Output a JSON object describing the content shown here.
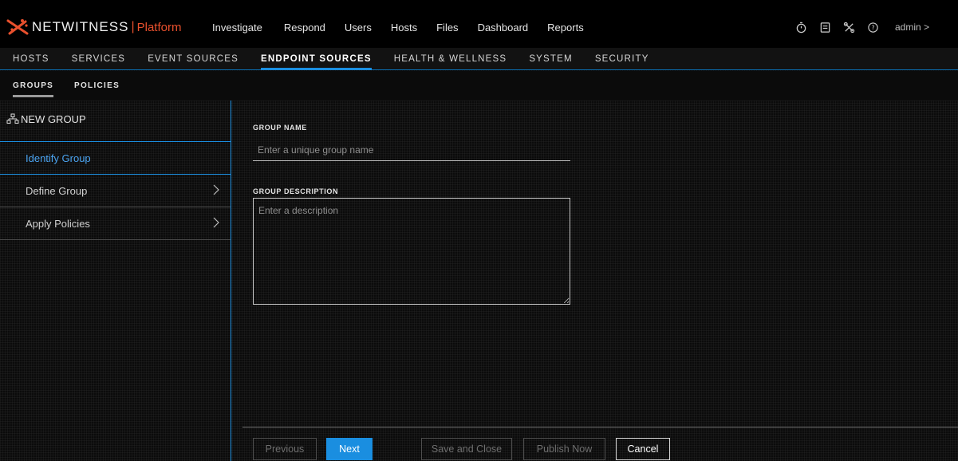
{
  "app": {
    "brand": "NETWITNESS",
    "brand_separator": "|",
    "platform": "Platform",
    "accent_color": "#e8502d"
  },
  "main_nav": [
    "Investigate",
    "Respond",
    "Users",
    "Hosts",
    "Files",
    "Dashboard",
    "Reports"
  ],
  "utility_icons": [
    "timer-icon",
    "jobs-icon",
    "tools-icon",
    "help-icon"
  ],
  "user": {
    "label": "admin >"
  },
  "admin_nav": {
    "items": [
      "HOSTS",
      "SERVICES",
      "EVENT SOURCES",
      "ENDPOINT SOURCES",
      "HEALTH & WELLNESS",
      "SYSTEM",
      "SECURITY"
    ],
    "active": "ENDPOINT SOURCES"
  },
  "sub_tabs": {
    "items": [
      "GROUPS",
      "POLICIES"
    ],
    "active": "GROUPS"
  },
  "wizard": {
    "title": "NEW GROUP",
    "steps": [
      "Identify Group",
      "Define Group",
      "Apply Policies"
    ],
    "active_step": "Identify Group"
  },
  "form": {
    "group_name_label": "GROUP NAME",
    "group_name_placeholder": "Enter a unique group name",
    "group_name_value": "",
    "group_description_label": "GROUP DESCRIPTION",
    "group_description_placeholder": "Enter a description",
    "group_description_value": ""
  },
  "footer": {
    "previous": "Previous",
    "next": "Next",
    "save_and_close": "Save and Close",
    "publish_now": "Publish Now",
    "cancel": "Cancel"
  },
  "colors": {
    "primary_blue": "#1a8ee0",
    "active_step_text": "#4aa3f0",
    "background": "#0b0b0b"
  }
}
